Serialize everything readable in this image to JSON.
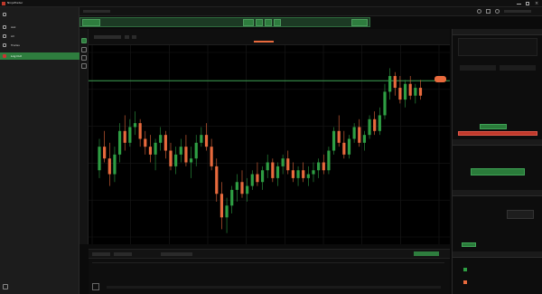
{
  "app": {
    "title": "NinjaTrader"
  },
  "sidebar": {
    "items": [
      {
        "label": ""
      },
      {
        "label": "Ask"
      },
      {
        "label": "All"
      },
      {
        "label": "Trades"
      },
      {
        "label": "Log Out"
      }
    ]
  },
  "colors": {
    "up": "#2e9e43",
    "down": "#e86a3d",
    "accent": "#2e7d3e",
    "danger": "#c0392b"
  },
  "chart_data": {
    "type": "candlestick",
    "ohlc": [
      [
        2.0,
        2.8,
        1.8,
        2.6
      ],
      [
        2.6,
        3.0,
        2.2,
        2.3
      ],
      [
        2.3,
        2.7,
        1.6,
        1.9
      ],
      [
        1.9,
        2.6,
        1.7,
        2.4
      ],
      [
        2.4,
        3.2,
        2.2,
        3.0
      ],
      [
        3.0,
        3.4,
        2.5,
        2.7
      ],
      [
        2.7,
        3.3,
        2.6,
        3.1
      ],
      [
        3.1,
        3.5,
        2.9,
        3.2
      ],
      [
        3.2,
        3.3,
        2.6,
        2.8
      ],
      [
        2.8,
        3.0,
        2.4,
        2.6
      ],
      [
        2.6,
        2.9,
        2.2,
        2.4
      ],
      [
        2.4,
        2.8,
        2.0,
        2.7
      ],
      [
        2.7,
        3.1,
        2.5,
        2.9
      ],
      [
        2.9,
        3.0,
        2.3,
        2.5
      ],
      [
        2.5,
        2.7,
        2.0,
        2.1
      ],
      [
        2.1,
        2.6,
        1.9,
        2.4
      ],
      [
        2.4,
        2.8,
        2.2,
        2.6
      ],
      [
        2.6,
        2.9,
        2.1,
        2.2
      ],
      [
        2.2,
        2.6,
        1.8,
        2.3
      ],
      [
        2.3,
        2.9,
        2.1,
        2.7
      ],
      [
        2.7,
        3.1,
        2.6,
        2.9
      ],
      [
        2.9,
        3.2,
        2.5,
        2.6
      ],
      [
        2.6,
        2.8,
        2.0,
        2.1
      ],
      [
        2.1,
        2.3,
        1.2,
        1.4
      ],
      [
        1.4,
        1.7,
        0.5,
        0.8
      ],
      [
        0.8,
        1.3,
        0.4,
        1.1
      ],
      [
        1.1,
        1.6,
        0.9,
        1.5
      ],
      [
        1.5,
        1.9,
        1.2,
        1.7
      ],
      [
        1.7,
        2.0,
        1.3,
        1.4
      ],
      [
        1.4,
        1.8,
        1.2,
        1.6
      ],
      [
        1.6,
        2.0,
        1.5,
        1.9
      ],
      [
        1.9,
        2.2,
        1.6,
        1.7
      ],
      [
        1.7,
        2.1,
        1.5,
        2.0
      ],
      [
        2.0,
        2.4,
        1.8,
        2.2
      ],
      [
        2.2,
        2.3,
        1.7,
        1.8
      ],
      [
        1.8,
        2.2,
        1.6,
        2.1
      ],
      [
        2.1,
        2.4,
        1.9,
        2.3
      ],
      [
        2.3,
        2.5,
        1.9,
        2.0
      ],
      [
        2.0,
        2.2,
        1.7,
        1.8
      ],
      [
        1.8,
        2.1,
        1.6,
        2.0
      ],
      [
        2.0,
        2.2,
        1.7,
        1.8
      ],
      [
        1.8,
        2.1,
        1.6,
        1.9
      ],
      [
        1.9,
        2.2,
        1.7,
        2.0
      ],
      [
        2.0,
        2.3,
        1.8,
        2.2
      ],
      [
        2.2,
        2.4,
        1.9,
        2.0
      ],
      [
        2.0,
        2.6,
        1.9,
        2.5
      ],
      [
        2.5,
        3.1,
        2.4,
        3.0
      ],
      [
        3.0,
        3.4,
        2.6,
        2.7
      ],
      [
        2.7,
        3.0,
        2.3,
        2.4
      ],
      [
        2.4,
        2.9,
        2.3,
        2.8
      ],
      [
        2.8,
        3.2,
        2.7,
        3.1
      ],
      [
        3.1,
        3.3,
        2.6,
        2.7
      ],
      [
        2.7,
        3.0,
        2.5,
        2.9
      ],
      [
        2.9,
        3.4,
        2.8,
        3.3
      ],
      [
        3.3,
        3.5,
        2.9,
        3.0
      ],
      [
        3.0,
        3.6,
        2.9,
        3.4
      ],
      [
        3.4,
        4.2,
        3.3,
        4.0
      ],
      [
        4.0,
        4.6,
        3.8,
        4.4
      ],
      [
        4.4,
        4.5,
        3.9,
        4.1
      ],
      [
        4.1,
        4.4,
        3.7,
        3.8
      ],
      [
        3.8,
        4.3,
        3.6,
        4.2
      ],
      [
        4.2,
        4.4,
        3.8,
        3.9
      ],
      [
        3.9,
        4.2,
        3.7,
        4.1
      ],
      [
        4.1,
        4.3,
        3.8,
        3.9
      ]
    ],
    "hline": 4.28,
    "ylim": [
      0.3,
      5.0
    ]
  },
  "orders": {
    "sell_label": "SELL",
    "buy_label": "BUY"
  }
}
